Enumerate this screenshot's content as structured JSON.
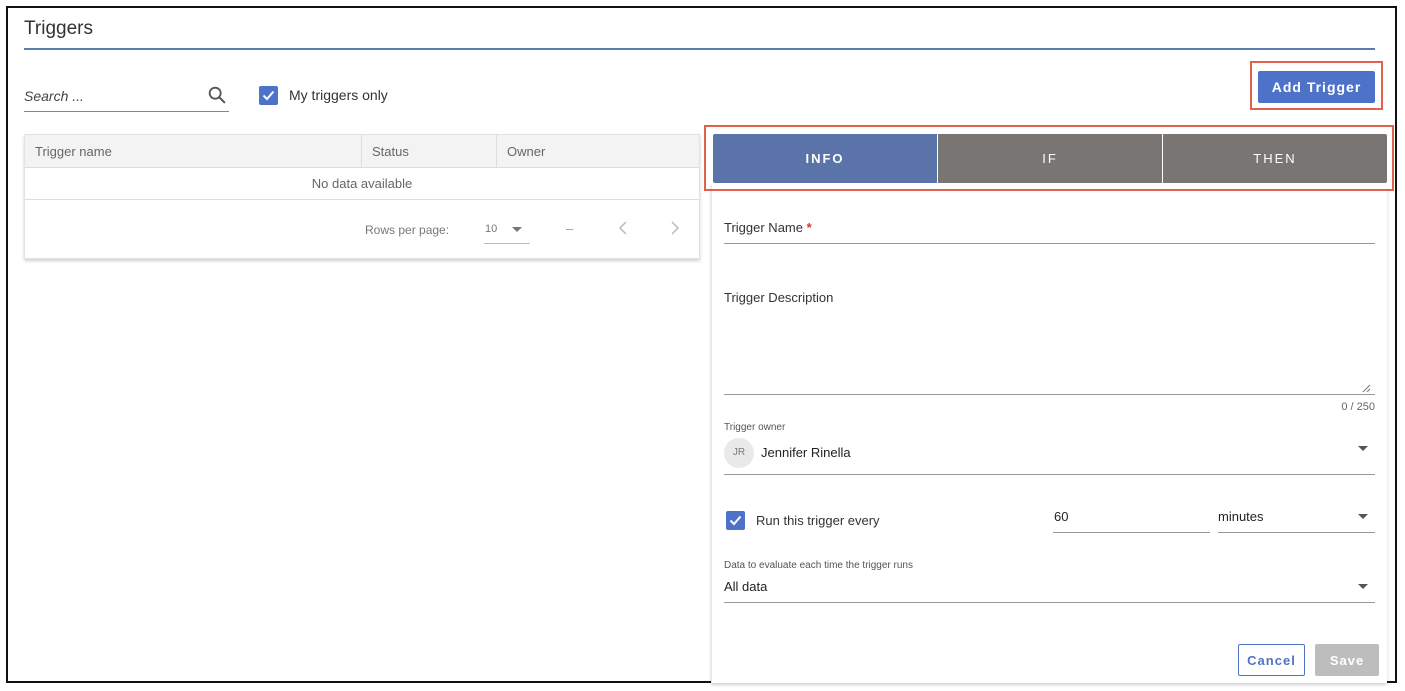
{
  "page": {
    "title": "Triggers"
  },
  "toolbar": {
    "search_placeholder": "Search ...",
    "search_value": "",
    "my_triggers_only_label": "My triggers only",
    "my_triggers_only_checked": true,
    "add_trigger_label": "Add Trigger",
    "accent_color": "#4e72c7",
    "highlight_color": "#e0624d"
  },
  "table": {
    "columns": [
      "Trigger name",
      "Status",
      "Owner"
    ],
    "rows": [],
    "empty_text": "No data available",
    "rows_per_page_label": "Rows per page:",
    "rows_per_page_value": "10",
    "range_text": "–"
  },
  "tabs": [
    {
      "label": "INFO",
      "active": true
    },
    {
      "label": "IF",
      "active": false
    },
    {
      "label": "THEN",
      "active": false
    }
  ],
  "form": {
    "trigger_name_label": "Trigger Name",
    "required_marker": "*",
    "trigger_name_value": "",
    "description_label": "Trigger Description",
    "description_value": "",
    "description_counter": "0 / 250",
    "owner_label": "Trigger owner",
    "owner_initials": "JR",
    "owner_name": "Jennifer Rinella",
    "run_every_label": "Run this trigger every",
    "run_every_checked": true,
    "run_every_value": "60",
    "run_every_unit": "minutes",
    "data_label": "Data to evaluate each time the trigger runs",
    "data_value": "All data",
    "cancel_label": "Cancel",
    "save_label": "Save"
  }
}
